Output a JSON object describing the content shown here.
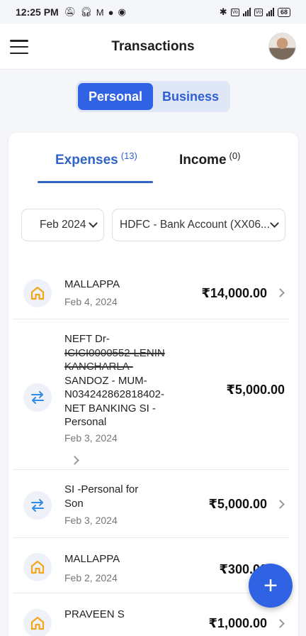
{
  "status_bar": {
    "time": "12:25 PM",
    "battery": "68"
  },
  "app_bar": {
    "title": "Transactions"
  },
  "segment": {
    "personal": "Personal",
    "business": "Business",
    "active": "personal"
  },
  "tabs": {
    "expenses_label": "Expenses",
    "expenses_count": "(13)",
    "income_label": "Income",
    "income_count": "(0)",
    "active": "expenses"
  },
  "filters": {
    "month": "Feb 2024",
    "account": "HDFC - Bank Account (XX06..."
  },
  "transactions": [
    {
      "icon": "home-icon",
      "name": "MALLAPPA",
      "date": "Feb 4, 2024",
      "amount": "₹14,000.00"
    },
    {
      "icon": "transfer-icon",
      "name_lines": [
        "NEFT Dr-",
        "ICICI0000552-LENIN",
        "KANCHARLA-",
        "SANDOZ - MUM-",
        "N034242862818402-",
        "NET BANKING SI -",
        "Personal"
      ],
      "date": "Feb 3, 2024",
      "amount": "₹5,000.00"
    },
    {
      "icon": "transfer-icon",
      "name_lines": [
        "SI -Personal for",
        "Son"
      ],
      "date": "Feb 3, 2024",
      "amount": "₹5,000.00"
    },
    {
      "icon": "home-icon",
      "name": "MALLAPPA",
      "date": "Feb 2, 2024",
      "amount": "₹300.00"
    },
    {
      "icon": "home-icon",
      "name": "PRAVEEN S",
      "date": "",
      "amount": "₹1,000.00"
    }
  ],
  "colors": {
    "accent": "#2f63e3",
    "tab_active": "#2f63c8",
    "home_icon": "#f3a51b",
    "transfer_icon": "#2f8de4"
  }
}
